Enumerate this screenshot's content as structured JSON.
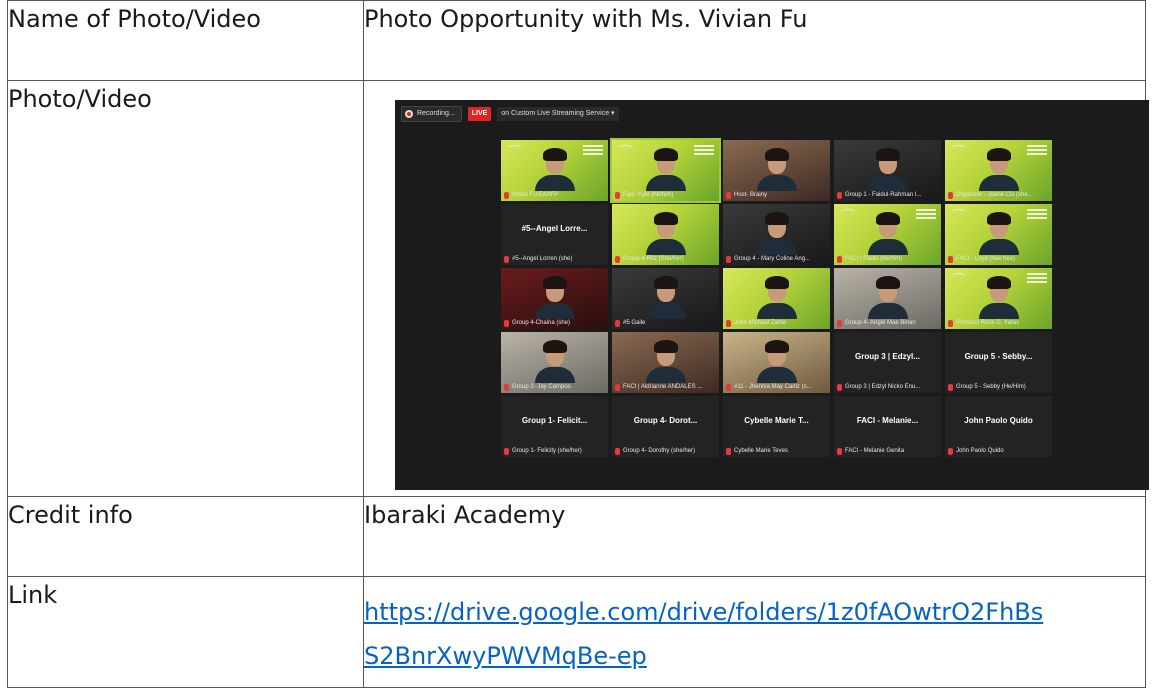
{
  "table": {
    "rows": [
      {
        "label": "Name of Photo/Video",
        "value": "Photo Opportunity with Ms. Vivian Fu"
      },
      {
        "label": "Photo/Video"
      },
      {
        "label": "Credit info",
        "value": "Ibaraki Academy"
      },
      {
        "label": "Link",
        "link_line1": "https://drive.google.com/drive/folders/1z0fAOwtrO2FhBs",
        "link_line2": "S2BnrXwyPWVMqBe-ep"
      }
    ],
    "link_color": "#0563c1"
  },
  "zoom": {
    "recording": "Recording...",
    "live": "LIVE",
    "stream": "on Custom Live Streaming Service ▾",
    "accent": "#9ccc3a",
    "tiles": [
      {
        "name": "Vivian Fu EAAFP",
        "style": "green",
        "face": true,
        "bird": true
      },
      {
        "name": "Faci- Kyle (he/him)",
        "style": "green",
        "face": true,
        "bird": true,
        "active": true
      },
      {
        "name": "Host- Brainy",
        "style": "warm",
        "face": true
      },
      {
        "name": "Group 1 - Faidul-Rahman I...",
        "style": "dark",
        "face": true
      },
      {
        "name": "Organizer - Joene Cis (she...",
        "style": "green",
        "face": true,
        "bird": true
      },
      {
        "name": "#5--Angel Lorren (she)",
        "style": "plain",
        "center": "#5--Angel Lorre..."
      },
      {
        "name": "Group 4-Ritz (She/her)",
        "style": "green",
        "face": true
      },
      {
        "name": "Group 4 - Mary Coline Ang...",
        "style": "dark",
        "face": true
      },
      {
        "name": "FACI | Paolo (he/him)",
        "style": "green",
        "face": true,
        "bird": true
      },
      {
        "name": "FACI - Loyd (hee hee)",
        "style": "green",
        "face": true,
        "bird": true
      },
      {
        "name": "Group 4-Chaina (she)",
        "style": "red",
        "face": true
      },
      {
        "name": "#5 Gaile",
        "style": "dark",
        "face": true
      },
      {
        "name": "John Michael Zante",
        "style": "green",
        "face": true
      },
      {
        "name": "Group 4- Angel Mae Binan",
        "style": "wall",
        "face": true
      },
      {
        "name": "Princess Rose D. Yaras",
        "style": "green",
        "face": true,
        "bird": true
      },
      {
        "name": "Group 2- Jay Campos",
        "style": "wall",
        "face": true
      },
      {
        "name": "FACI | Aldrianne ANDALES ...",
        "style": "warm",
        "face": true
      },
      {
        "name": "#11 - Jhennia May Cadiz (s...",
        "style": "room",
        "face": true
      },
      {
        "name": "Group 3 | Edzyl Nicko Enu...",
        "style": "plain",
        "center": "Group 3 | Edzyl..."
      },
      {
        "name": "Group 5 - Sebby (He/Him)",
        "style": "plain",
        "center": "Group 5 - Sebby..."
      },
      {
        "name": "Group 1- Felicity (she/her)",
        "style": "plain",
        "center": "Group 1- Felicit..."
      },
      {
        "name": "Group 4- Dorothy (she/her)",
        "style": "plain",
        "center": "Group 4- Dorot..."
      },
      {
        "name": "Cybelle Marie Teves",
        "style": "plain",
        "center": "Cybelle Marie T..."
      },
      {
        "name": "FACI - Melanie Genita",
        "style": "plain",
        "center": "FACI - Melanie..."
      },
      {
        "name": "John Paolo Quido",
        "style": "plain",
        "center": "John Paolo Quido"
      }
    ]
  }
}
